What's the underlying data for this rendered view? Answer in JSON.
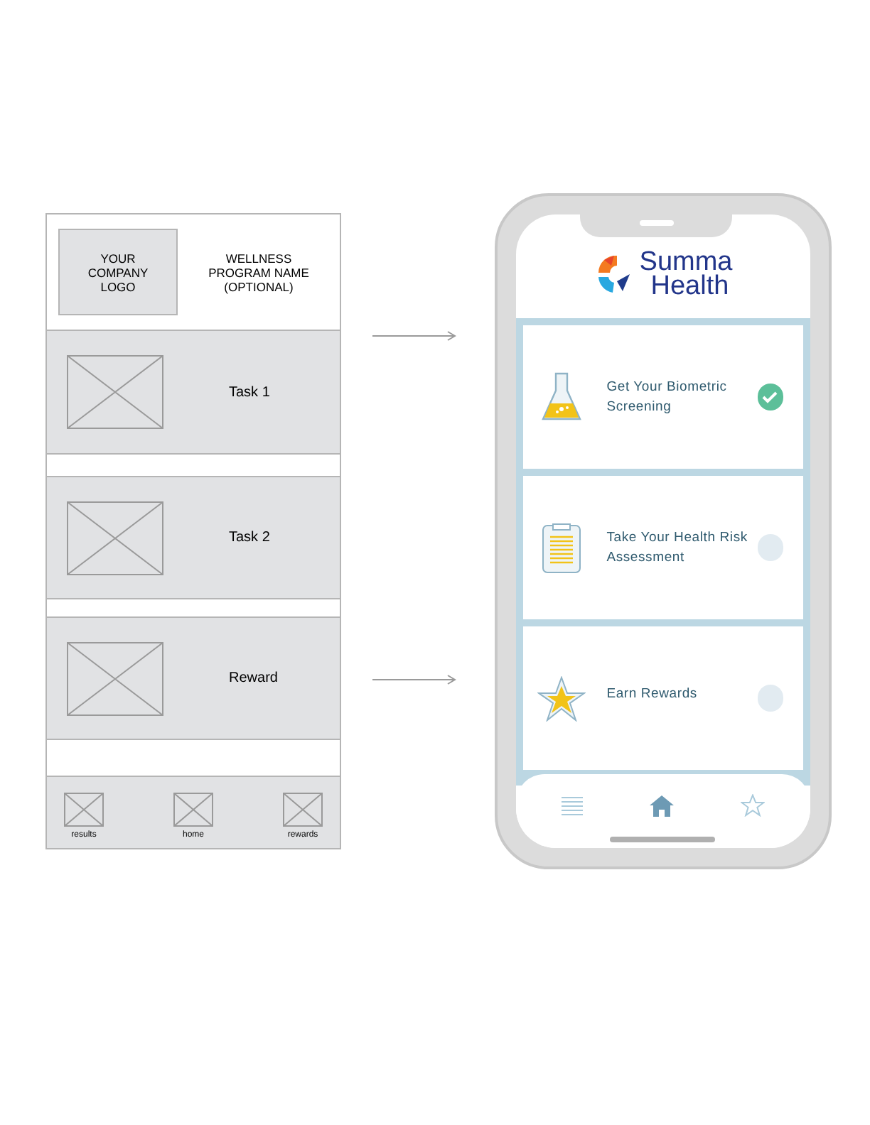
{
  "wireframe": {
    "logo_placeholder": "YOUR COMPANY LOGO",
    "program_name": "WELLNESS PROGRAM NAME (OPTIONAL)",
    "rows": [
      {
        "label": "Task 1"
      },
      {
        "label": "Task 2"
      },
      {
        "label": "Reward"
      }
    ],
    "nav": [
      {
        "label": "results"
      },
      {
        "label": "home"
      },
      {
        "label": "rewards"
      }
    ]
  },
  "app": {
    "logo": {
      "line_1": "Summa",
      "line_2": "Health"
    },
    "tasks": [
      {
        "title": "Get Your Biometric Screening",
        "kind": "flask",
        "completed": true
      },
      {
        "title": "Take Your Health Risk Assessment",
        "kind": "clipboard",
        "completed": false
      },
      {
        "title": "Earn Rewards",
        "kind": "star",
        "completed": false
      }
    ],
    "nav": [
      {
        "kind": "list",
        "selected": false
      },
      {
        "kind": "home",
        "selected": true
      },
      {
        "kind": "star",
        "selected": false
      }
    ]
  }
}
